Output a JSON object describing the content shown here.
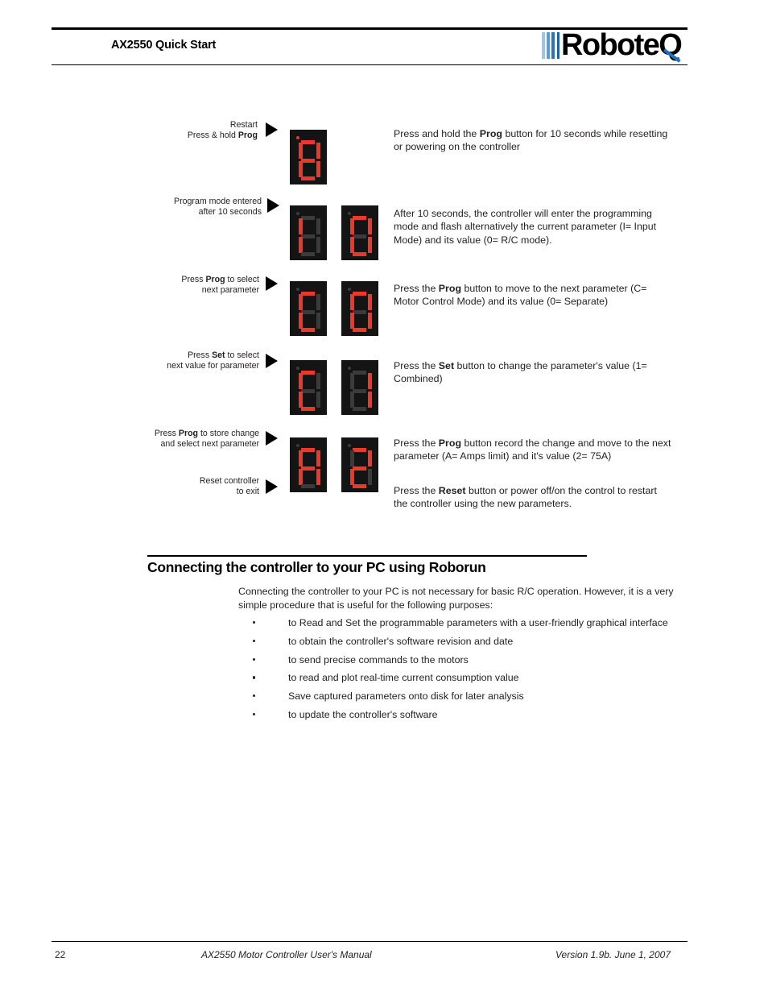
{
  "header": {
    "title": "AX2550 Quick Start",
    "logo_text": "RoboteQ",
    "logo_bar_colors": [
      "#9ec4e8",
      "#5d9bd4",
      "#2f72b8",
      "#1f5fa8"
    ],
    "logo_tail_color": "#1f6fc0"
  },
  "display_colors": {
    "segment_on": "#e8392b",
    "segment_off": "#3b3b3b",
    "panel_background": "#141414"
  },
  "diagram": {
    "steps": [
      {
        "caption_lines": [
          "Restart",
          "Press & hold Prog"
        ],
        "caption_bold_words": [
          "Prog"
        ],
        "displays": [
          "8"
        ],
        "description_html": "Press and hold the <b>Prog</b> button for 10 seconds while resetting or powering on the controller",
        "description_text": "Press and hold the Prog button for 10 seconds while resetting or powering on the controller"
      },
      {
        "caption_lines": [
          "Program mode entered",
          "after 10 seconds"
        ],
        "caption_bold_words": [],
        "displays": [
          "I",
          "0"
        ],
        "description_html": "After 10 seconds, the controller will enter the programming mode and flash alternatively the current parameter (I= Input Mode) and its value (0= R/C mode).",
        "description_text": "After 10 seconds, the controller will enter the programming mode and flash alternatively the current parameter (I= Input Mode) and its value (0= R/C mode)."
      },
      {
        "caption_lines": [
          "Press Prog to select",
          "next parameter"
        ],
        "caption_bold_words": [
          "Prog"
        ],
        "displays": [
          "C",
          "0"
        ],
        "description_html": "Press the <b>Prog</b> button to move to the next parameter (C= Motor Control Mode) and its value (0= Separate)",
        "description_text": "Press the Prog button to move to the next parameter (C= Motor Control Mode) and its value (0= Separate)"
      },
      {
        "caption_lines": [
          "Press Set to select",
          "next value for parameter"
        ],
        "caption_bold_words": [
          "Set"
        ],
        "displays": [
          "C",
          "1"
        ],
        "description_html": "Press the <b>Set</b> button to change the parameter's value (1= Combined)",
        "description_text": "Press the Set button to change the parameter's value (1= Combined)"
      },
      {
        "caption_lines": [
          "Press Prog to store change",
          "and select next parameter"
        ],
        "caption_bold_words": [
          "Prog"
        ],
        "displays": [
          "A",
          "2"
        ],
        "description_html": "Press the <b>Prog</b> button record the change and move to the next parameter (A= Amps limit) and it's value (2= 75A)",
        "description_text": "Press the Prog button record the change and move to the next parameter (A= Amps limit) and it's value (2= 75A)"
      },
      {
        "caption_lines": [
          "Reset controller",
          "to exit"
        ],
        "caption_bold_words": [],
        "displays": [],
        "description_html": "Press the <b>Reset</b> button or power off/on the control to restart the controller using the new parameters.",
        "description_text": "Press the Reset button or power off/on the control to restart the controller using the new parameters."
      }
    ]
  },
  "section": {
    "heading": "Connecting the controller to your PC using Roborun",
    "intro": "Connecting the controller to your PC is not necessary for basic R/C operation. However, it is a very simple procedure that is useful for the following purposes:",
    "bullets": [
      "to Read and Set the programmable parameters with a user-friendly graphical interface",
      "to obtain the controller's software revision and date",
      "to send precise commands to the motors",
      "to read and plot real-time current consumption value",
      "Save captured parameters onto disk for later analysis",
      "to update the controller's software"
    ]
  },
  "footer": {
    "page_number": "22",
    "manual_title": "AX2550 Motor Controller User's Manual",
    "version": "Version 1.9b. June 1, 2007"
  }
}
